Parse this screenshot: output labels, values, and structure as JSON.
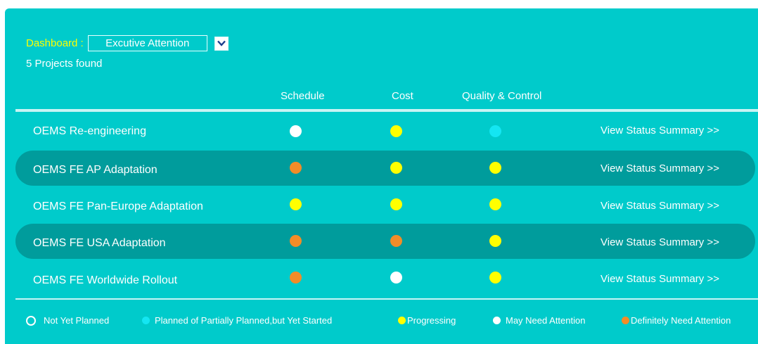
{
  "header": {
    "dashboard_label": "Dashboard :",
    "dashboard_value": "Excutive Attention",
    "projects_found": "5 Projects found"
  },
  "columns": {
    "schedule": "Schedule",
    "cost": "Cost",
    "quality": "Quality & Control"
  },
  "status_colors": {
    "not-planned": "#ffffff",
    "planned": "#14e6f2",
    "progressing": "#ffff00",
    "may-need-attention": "#ffffff",
    "definitely-need-attention": "#f28c28"
  },
  "projects": [
    {
      "name": "OEMS Re-engineering",
      "schedule": "may-need-attention",
      "cost": "progressing",
      "quality": "planned",
      "link": "View Status Summary >>"
    },
    {
      "name": "OEMS FE AP Adaptation",
      "schedule": "definitely-need-attention",
      "cost": "progressing",
      "quality": "progressing",
      "link": "View Status Summary >>"
    },
    {
      "name": "OEMS FE Pan-Europe Adaptation",
      "schedule": "progressing",
      "cost": "progressing",
      "quality": "progressing",
      "link": "View Status Summary >>"
    },
    {
      "name": "OEMS FE USA Adaptation",
      "schedule": "definitely-need-attention",
      "cost": "definitely-need-attention",
      "quality": "progressing",
      "link": "View Status Summary >>"
    },
    {
      "name": "OEMS FE Worldwide Rollout",
      "schedule": "definitely-need-attention",
      "cost": "may-need-attention",
      "quality": "progressing",
      "link": "View Status Summary >>"
    }
  ],
  "legend": {
    "not_planned": "Not Yet Planned",
    "planned": "Planned of Partially Planned,but Yet Started",
    "progressing": "Progressing",
    "may_need": "May Need Attention",
    "definitely": "Definitely Need Attention"
  }
}
